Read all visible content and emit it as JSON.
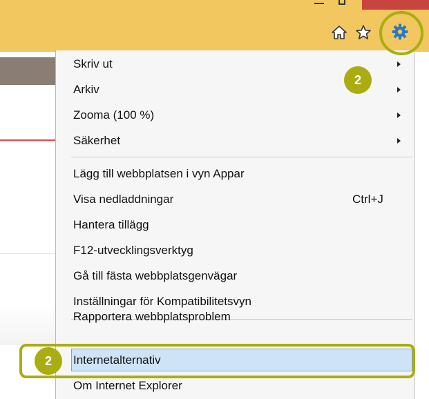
{
  "menu": {
    "items": [
      {
        "label": "Skriv ut",
        "shortcut": "",
        "submenu": true
      },
      {
        "label": "Arkiv",
        "shortcut": "",
        "submenu": true
      },
      {
        "label": "Zooma (100 %)",
        "shortcut": "",
        "submenu": true
      },
      {
        "label": "Säkerhet",
        "shortcut": "",
        "submenu": true
      },
      {
        "label": "Lägg till webbplatsen i vyn Appar",
        "shortcut": "",
        "submenu": false
      },
      {
        "label": "Visa nedladdningar",
        "shortcut": "Ctrl+J",
        "submenu": false
      },
      {
        "label": "Hantera tillägg",
        "shortcut": "",
        "submenu": false
      },
      {
        "label": "F12-utvecklingsverktyg",
        "shortcut": "",
        "submenu": false
      },
      {
        "label": "Gå till fästa webbplatsgenvägar",
        "shortcut": "",
        "submenu": false
      },
      {
        "label": "Inställningar för Kompatibilitetsvyn",
        "shortcut": "",
        "submenu": false
      },
      {
        "label": "Rapportera webbplatsproblem",
        "shortcut": "",
        "submenu": false
      },
      {
        "label": "Internetalternativ",
        "shortcut": "",
        "submenu": false,
        "highlighted": true
      },
      {
        "label": "Om Internet Explorer",
        "shortcut": "",
        "submenu": false
      }
    ]
  },
  "annotations": {
    "badge_top": "2",
    "badge_bottom": "2",
    "accent_color": "#a9ad12"
  },
  "toolbar": {
    "icons": [
      "home-icon",
      "star-icon",
      "gear-icon"
    ],
    "bar_color": "#f2c75f"
  }
}
